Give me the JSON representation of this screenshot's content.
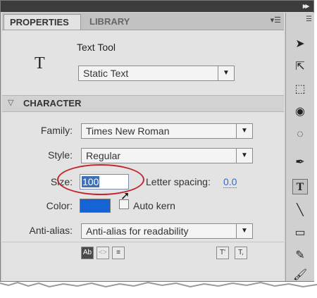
{
  "tabs": {
    "properties": "PROPERTIES",
    "library": "LIBRARY"
  },
  "tool": {
    "icon_glyph": "T",
    "name": "Text Tool",
    "text_type": "Static Text"
  },
  "character": {
    "section_title": "CHARACTER",
    "family_label": "Family:",
    "family_value": "Times New Roman",
    "style_label": "Style:",
    "style_value": "Regular",
    "size_label": "Size:",
    "size_value": "100",
    "letter_spacing_label": "Letter spacing:",
    "letter_spacing_value": "0.0",
    "color_label": "Color:",
    "color_value": "#1563d5",
    "auto_kern_label": "Auto kern",
    "anti_alias_label": "Anti-alias:",
    "anti_alias_value": "Anti-alias for readability"
  },
  "bottom_icons": {
    "selectable": "Ab",
    "render_html": "<>",
    "border": "≡",
    "superscript": "T'",
    "subscript": "T,"
  },
  "toolbar_icons": [
    "selection-tool",
    "subselection-tool",
    "free-transform-tool",
    "3d-rotation-tool",
    "lasso-tool",
    "pen-tool",
    "text-tool",
    "line-tool",
    "rectangle-tool",
    "pencil-tool",
    "brush-tool"
  ],
  "highlight_color": "#c1272d"
}
